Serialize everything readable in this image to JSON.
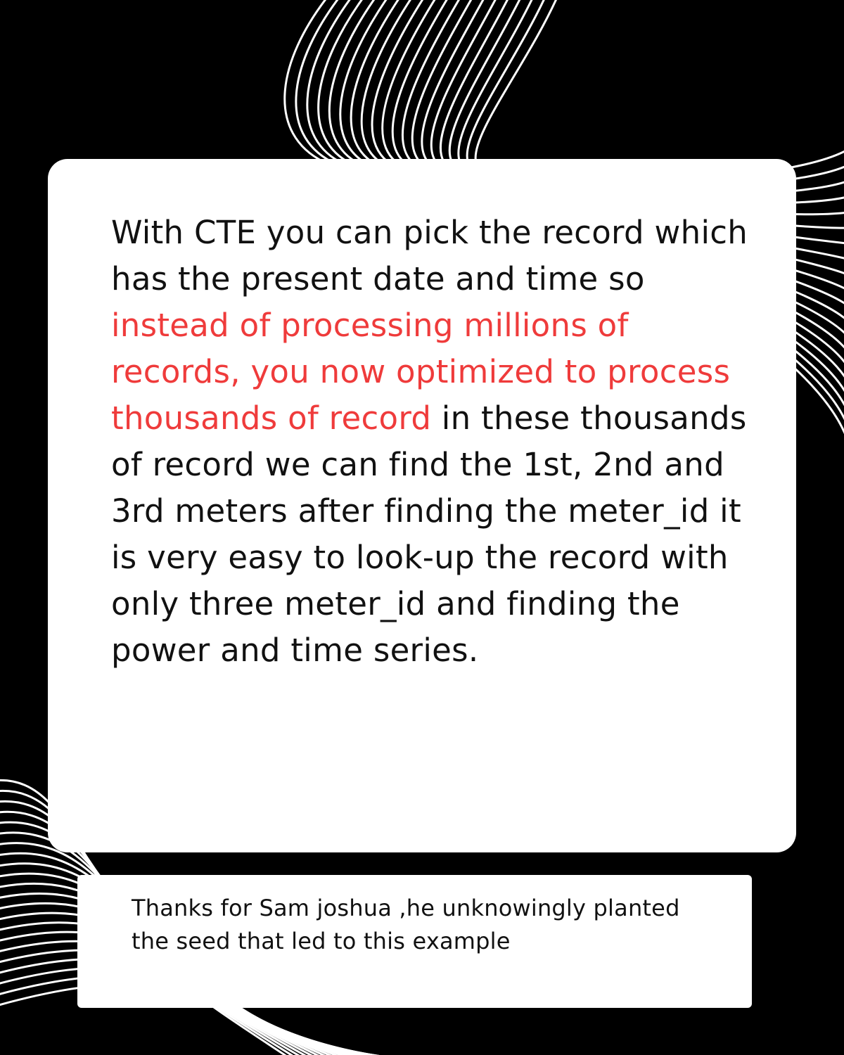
{
  "colors": {
    "background": "#000000",
    "card": "#ffffff",
    "text": "#111111",
    "highlight": "#ef3b3b",
    "lines": "#ffffff"
  },
  "decoration": {
    "top_right_icon": "contour-lines",
    "bottom_left_icon": "contour-lines"
  },
  "main_card": {
    "segments": [
      {
        "text": "With CTE you can pick the record which has the present date and time so ",
        "highlight": false
      },
      {
        "text": "instead of processing millions of records, you now optimized to process thousands of record",
        "highlight": true
      },
      {
        "text": " in these thousands of record we can find the 1st, 2nd and 3rd meters after finding the meter_id it is very easy to look-up the record with only three meter_id and finding the power and time series.",
        "highlight": false
      }
    ]
  },
  "credit_card": {
    "text": "Thanks for Sam joshua ,he unknowingly planted the seed that led to this example"
  }
}
